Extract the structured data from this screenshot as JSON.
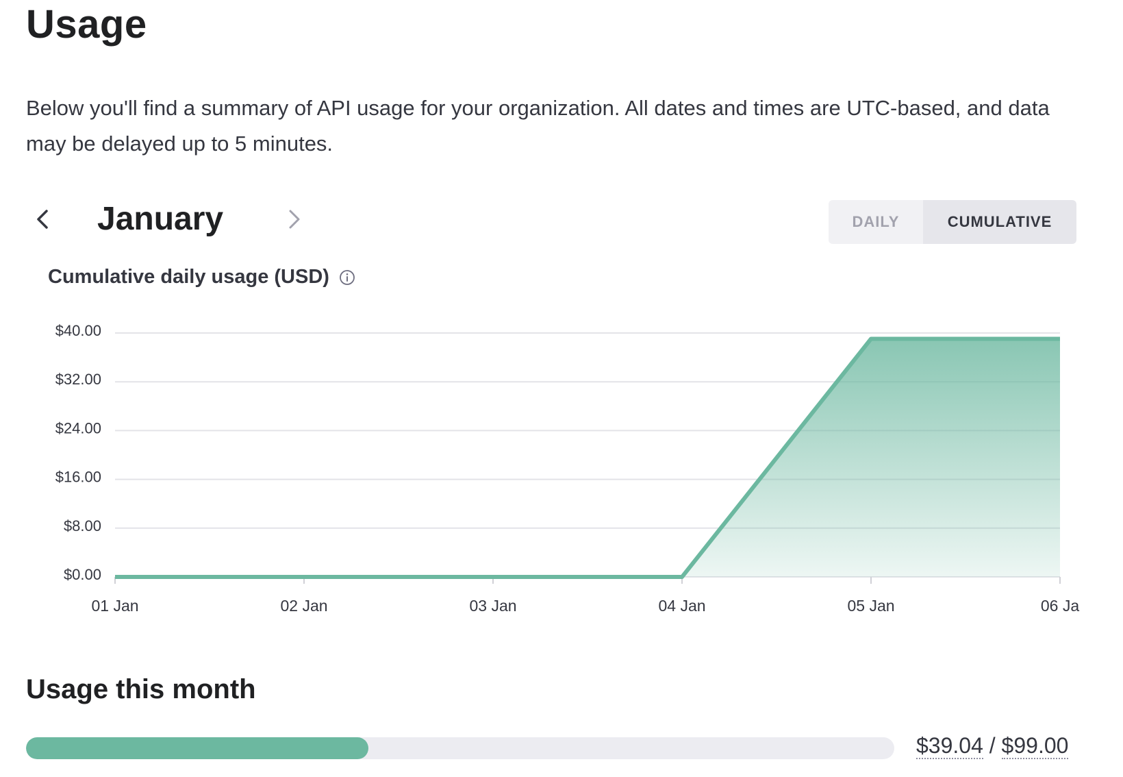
{
  "page": {
    "title": "Usage",
    "intro": "Below you'll find a summary of API usage for your organization. All dates and times are UTC-based, and data may be delayed up to 5 minutes."
  },
  "month_nav": {
    "month": "January",
    "prev_icon": "chevron-left-icon",
    "next_icon": "chevron-right-icon"
  },
  "view_toggle": {
    "options": [
      "DAILY",
      "CUMULATIVE"
    ],
    "selected": "CUMULATIVE"
  },
  "chart_data": {
    "type": "area",
    "title": "Cumulative daily usage (USD)",
    "title_icon": "info-icon",
    "x": [
      "01 Jan",
      "02 Jan",
      "03 Jan",
      "04 Jan",
      "05 Jan",
      "06 Ja"
    ],
    "y_ticks": [
      "$0.00",
      "$8.00",
      "$16.00",
      "$24.00",
      "$32.00",
      "$40.00"
    ],
    "ylim": [
      0,
      40
    ],
    "grid": true,
    "series": [
      {
        "values": [
          0,
          0,
          0,
          0,
          39.04,
          39.04
        ]
      }
    ],
    "colors": {
      "line": "#6cb8a0",
      "fill": "#6cb8a0",
      "grid": "#e3e3e8"
    }
  },
  "usage_this_month": {
    "title": "Usage this month",
    "used": "$39.04",
    "separator": "/",
    "limit": "$99.00",
    "fraction": 0.3943
  }
}
